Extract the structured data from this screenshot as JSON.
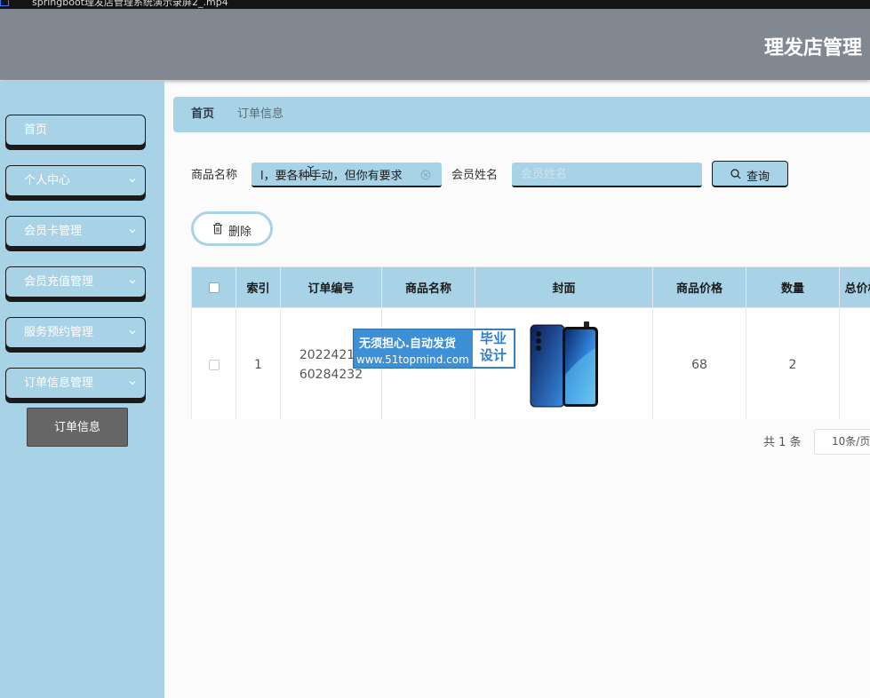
{
  "window": {
    "path": "springboot理发店管理系统演示录屏2_.mp4"
  },
  "header": {
    "title": "理发店管理"
  },
  "sidebar": {
    "items": [
      {
        "label": "首页",
        "has_arrow": false
      },
      {
        "label": "个人中心",
        "has_arrow": true
      },
      {
        "label": "会员卡管理",
        "has_arrow": true
      },
      {
        "label": "会员充值管理",
        "has_arrow": true
      },
      {
        "label": "服务预约管理",
        "has_arrow": true
      },
      {
        "label": "订单信息管理",
        "has_arrow": true
      }
    ],
    "submenu": {
      "label": "订单信息"
    }
  },
  "breadcrumb": {
    "home": "首页",
    "separator": "/",
    "current": "订单信息"
  },
  "search": {
    "product_label": "商品名称",
    "product_value": "l，要各种手动，但你有要求",
    "member_label": "会员姓名",
    "member_placeholder": "会员姓名",
    "query_label": "查询"
  },
  "actions": {
    "delete_label": "删除"
  },
  "table": {
    "columns": [
      "索引",
      "订单编号",
      "商品名称",
      "封面",
      "商品价格",
      "数量",
      "总价格"
    ],
    "rows": [
      {
        "index": "1",
        "order_no_line1": "20224213",
        "order_no_line2": "60284232",
        "product_name": "",
        "price": "68",
        "quantity": "2"
      }
    ]
  },
  "watermark": {
    "line1": "无须担心.自动发货",
    "line2": "www.51topmind.com",
    "badge_line1": "毕业",
    "badge_line2": "设计"
  },
  "pagination": {
    "total": "共 1 条",
    "page_size": "10条/页"
  },
  "colors": {
    "accent": "#a8d2e6",
    "header": "#818891",
    "submenu": "#666666",
    "watermark": "#3d8fd6"
  }
}
